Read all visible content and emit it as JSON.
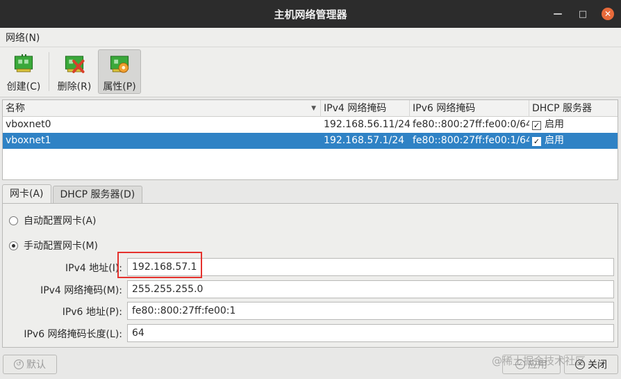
{
  "window": {
    "title": "主机网络管理器"
  },
  "menu": {
    "network": "网络(N)"
  },
  "toolbar": {
    "create": "创建(C)",
    "delete": "删除(R)",
    "properties": "属性(P)"
  },
  "table": {
    "headers": [
      "名称",
      "IPv4 网络掩码",
      "IPv6 网络掩码",
      "DHCP 服务器"
    ],
    "rows": [
      {
        "name": "vboxnet0",
        "ipv4": "192.168.56.11/24",
        "ipv6": "fe80::800:27ff:fe00:0/64",
        "dhcp": "启用",
        "dhcp_checked": true,
        "selected": false
      },
      {
        "name": "vboxnet1",
        "ipv4": "192.168.57.1/24",
        "ipv6": "fe80::800:27ff:fe00:1/64",
        "dhcp": "启用",
        "dhcp_checked": true,
        "selected": true
      }
    ]
  },
  "tabs": {
    "adapter": "网卡(A)",
    "dhcp_server": "DHCP 服务器(D)"
  },
  "adapter": {
    "auto_config": "自动配置网卡(A)",
    "manual_config": "手动配置网卡(M)",
    "manual_selected": true,
    "ipv4_address_label": "IPv4 地址(I):",
    "ipv4_address_value": "192.168.57.1",
    "ipv4_mask_label": "IPv4 网络掩码(M):",
    "ipv4_mask_value": "255.255.255.0",
    "ipv6_address_label": "IPv6 地址(P):",
    "ipv6_address_value": "fe80::800:27ff:fe00:1",
    "ipv6_prefix_label": "IPv6 网络掩码长度(L):",
    "ipv6_prefix_value": "64"
  },
  "buttons": {
    "default": "默认",
    "apply": "应用",
    "close": "关闭"
  },
  "watermark": "@稀土掘金技术社区",
  "colors": {
    "titlebar": "#2c2c2c",
    "selection": "#2f82c5",
    "highlight_box": "#e5322d",
    "close_button": "#e86a3a"
  }
}
